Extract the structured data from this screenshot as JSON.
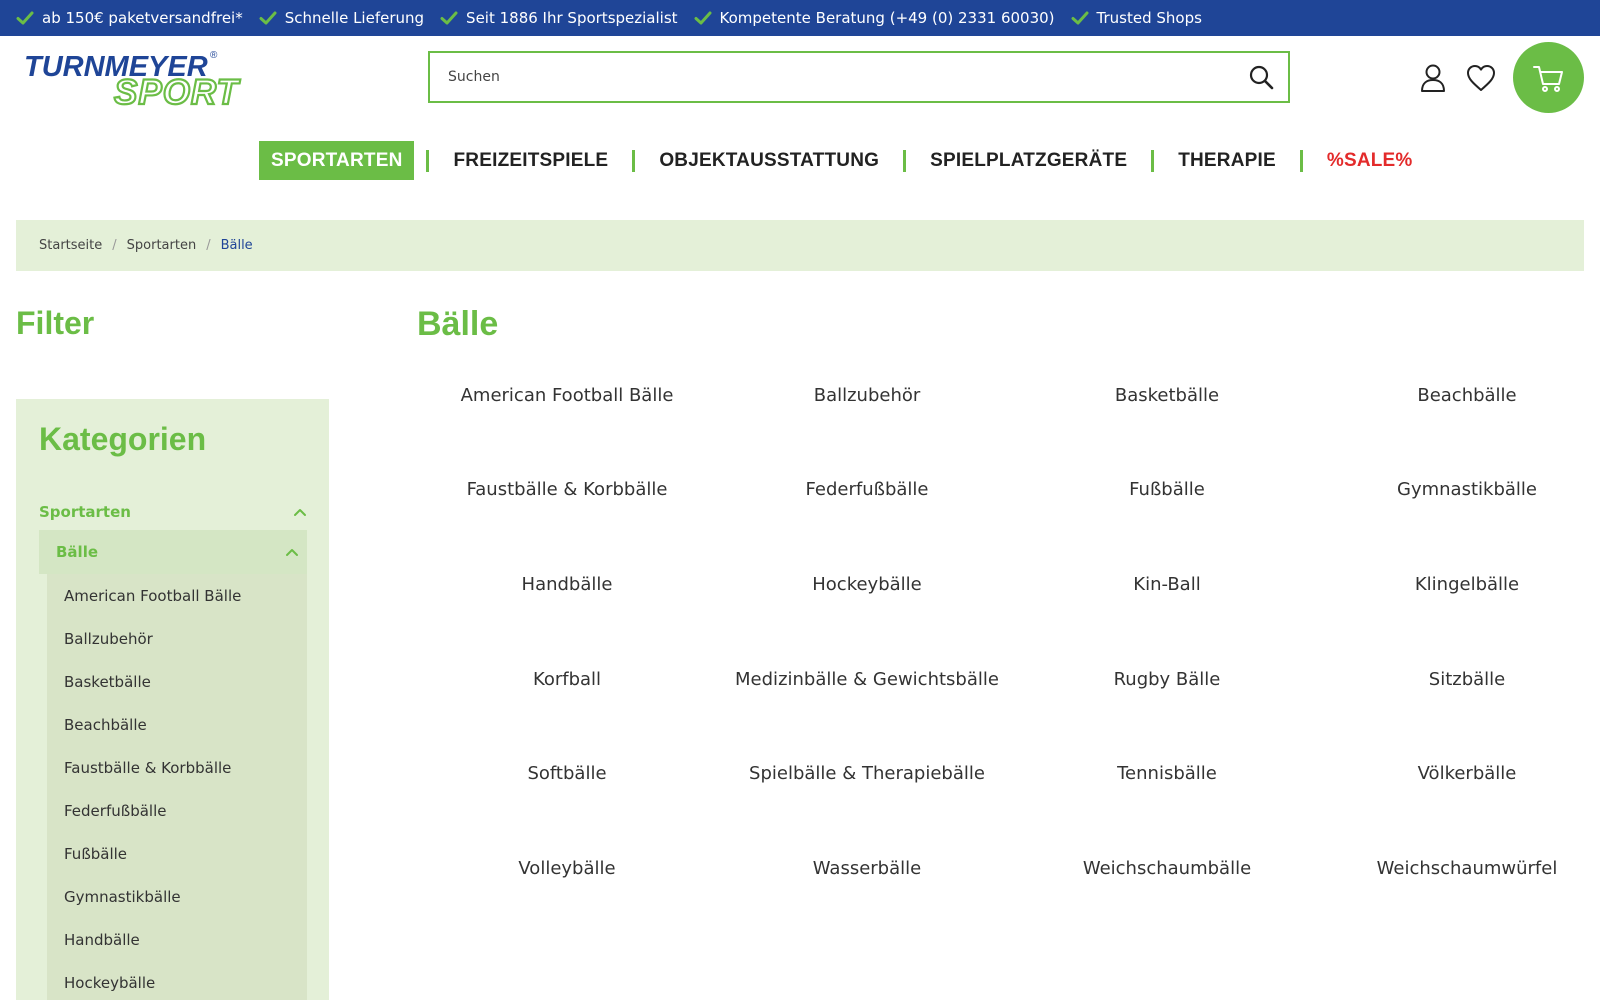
{
  "topbar": {
    "items": [
      "ab 150€ paketversandfrei*",
      "Schnelle Lieferung",
      "Seit 1886 Ihr Sportspezialist",
      "Kompetente Beratung (+49 (0) 2331 60030)",
      "Trusted Shops"
    ]
  },
  "header": {
    "logo": {
      "line1": "TURNMEYER",
      "line2": "SPORT",
      "registered": "®"
    },
    "search": {
      "placeholder": "Suchen"
    },
    "icons": [
      "user-icon",
      "heart-icon",
      "cart-icon"
    ]
  },
  "nav": {
    "items": [
      "SPORTARTEN",
      "FREIZEITSPIELE",
      "OBJEKTAUSSTATTUNG",
      "SPIELPLATZGERÄTE",
      "THERAPIE",
      "%SALE%"
    ],
    "active": "SPORTARTEN"
  },
  "breadcrumb": [
    "Startseite",
    "Sportarten",
    "Bälle"
  ],
  "filter": {
    "title": "Filter",
    "categories_title": "Kategorien",
    "level1": "Sportarten",
    "level2": "Bälle",
    "items": [
      "American Football Bälle",
      "Ballzubehör",
      "Basketbälle",
      "Beachbälle",
      "Faustbälle & Korbbälle",
      "Federfußbälle",
      "Fußbälle",
      "Gymnastikbälle",
      "Handbälle",
      "Hockeybälle"
    ]
  },
  "main": {
    "title": "Bälle",
    "categories": [
      "American Football Bälle",
      "Ballzubehör",
      "Basketbälle",
      "Beachbälle",
      "Faustbälle & Korbbälle",
      "Federfußbälle",
      "Fußbälle",
      "Gymnastikbälle",
      "Handbälle",
      "Hockeybälle",
      "Kin-Ball",
      "Klingelbälle",
      "Korfball",
      "Medizinbälle & Gewichtsbälle",
      "Rugby Bälle",
      "Sitzbälle",
      "Softbälle",
      "Spielbälle & Therapiebälle",
      "Tennisbälle",
      "Völkerbälle",
      "Volleybälle",
      "Wasserbälle",
      "Weichschaumbälle",
      "Weichschaumwürfel"
    ]
  },
  "colors": {
    "brand_blue": "#1f4597",
    "brand_green": "#6bbd46",
    "sale_red": "#e32b2b",
    "sidebar_bg": "#e4f0d8"
  }
}
